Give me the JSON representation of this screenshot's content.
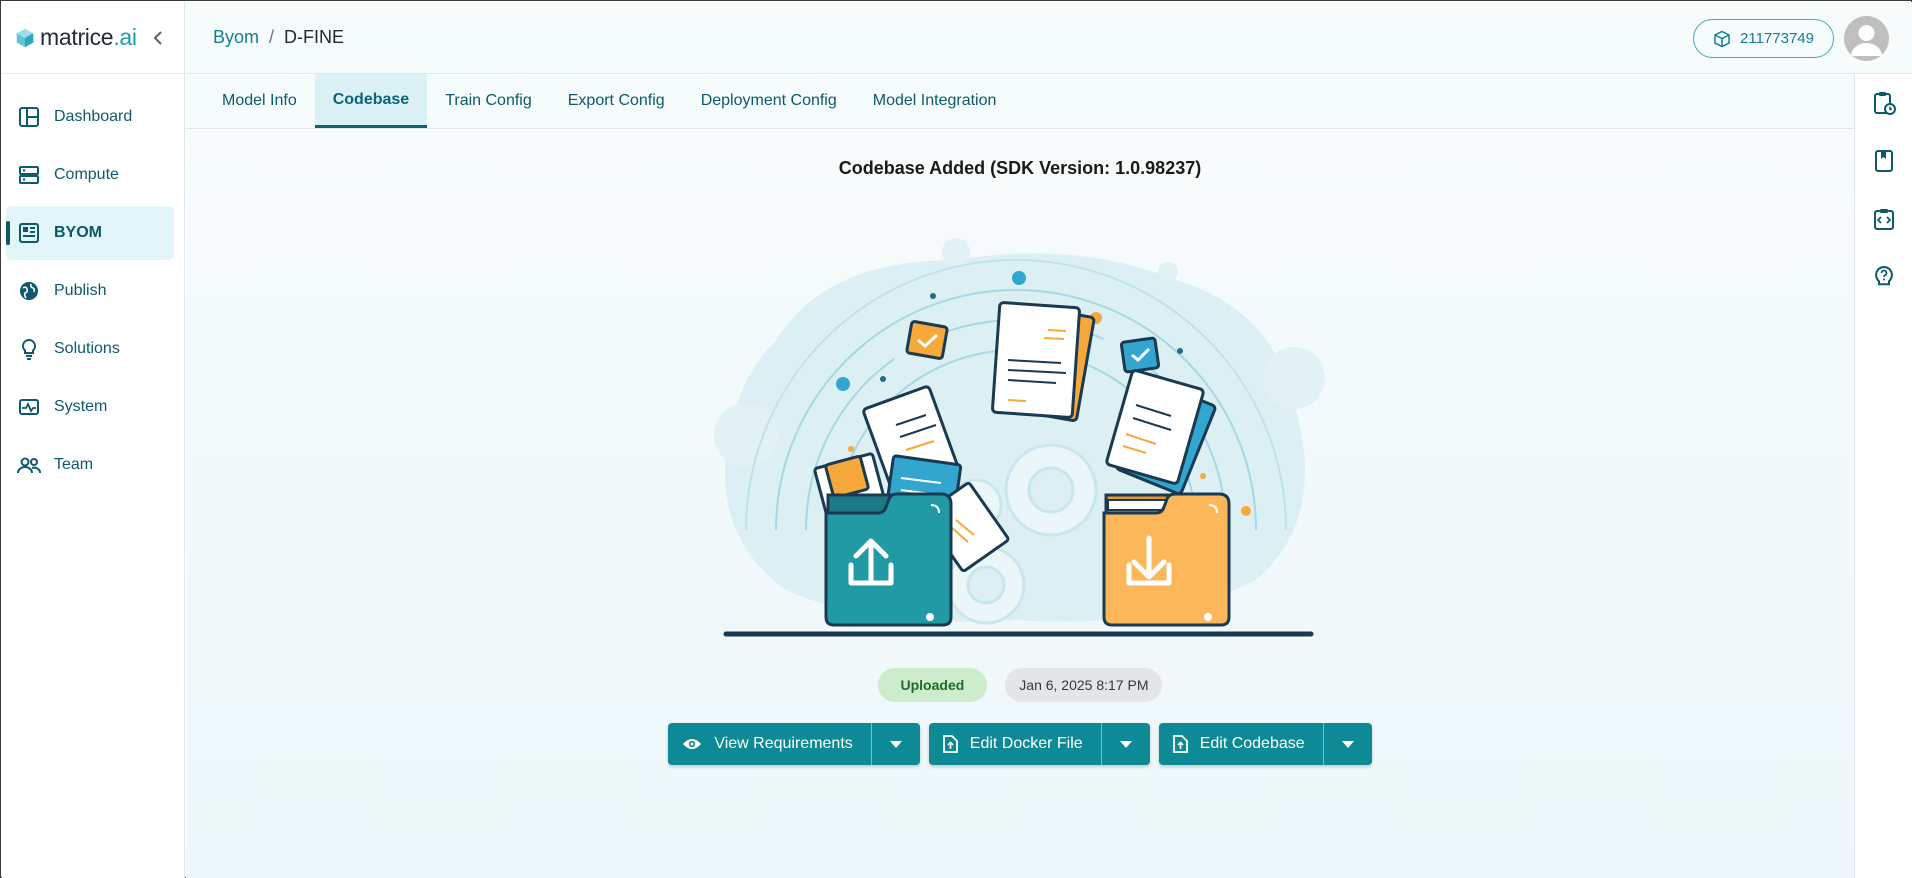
{
  "brand": {
    "name": "matrice",
    "suffix": ".ai"
  },
  "sidebar": {
    "items": [
      {
        "label": "Dashboard",
        "icon": "dashboard-icon"
      },
      {
        "label": "Compute",
        "icon": "server-icon"
      },
      {
        "label": "BYOM",
        "icon": "byom-icon",
        "active": true
      },
      {
        "label": "Publish",
        "icon": "globe-icon"
      },
      {
        "label": "Solutions",
        "icon": "lightbulb-icon"
      },
      {
        "label": "System",
        "icon": "pulse-icon"
      },
      {
        "label": "Team",
        "icon": "team-icon"
      }
    ]
  },
  "header": {
    "breadcrumb": {
      "parent": "Byom",
      "separator": "/",
      "current": "D-FINE"
    },
    "credits": "211773749"
  },
  "tabs": [
    "Model Info",
    "Codebase",
    "Train Config",
    "Export Config",
    "Deployment Config",
    "Model Integration"
  ],
  "active_tab": "Codebase",
  "rail": [
    "clipboard-clock-icon",
    "book-icon",
    "code-clipboard-icon",
    "help-icon"
  ],
  "main": {
    "title": "Codebase Added (SDK Version: 1.0.98237)",
    "status": "Uploaded",
    "timestamp": "Jan 6, 2025 8:17 PM",
    "buttons": {
      "view_requirements": "View Requirements",
      "edit_docker": "Edit Docker File",
      "edit_codebase": "Edit Codebase"
    }
  },
  "colors": {
    "primary": "#0e8a96",
    "accent": "#137f93",
    "orange": "#f7a83a",
    "teal_dark": "#1c7a86"
  }
}
